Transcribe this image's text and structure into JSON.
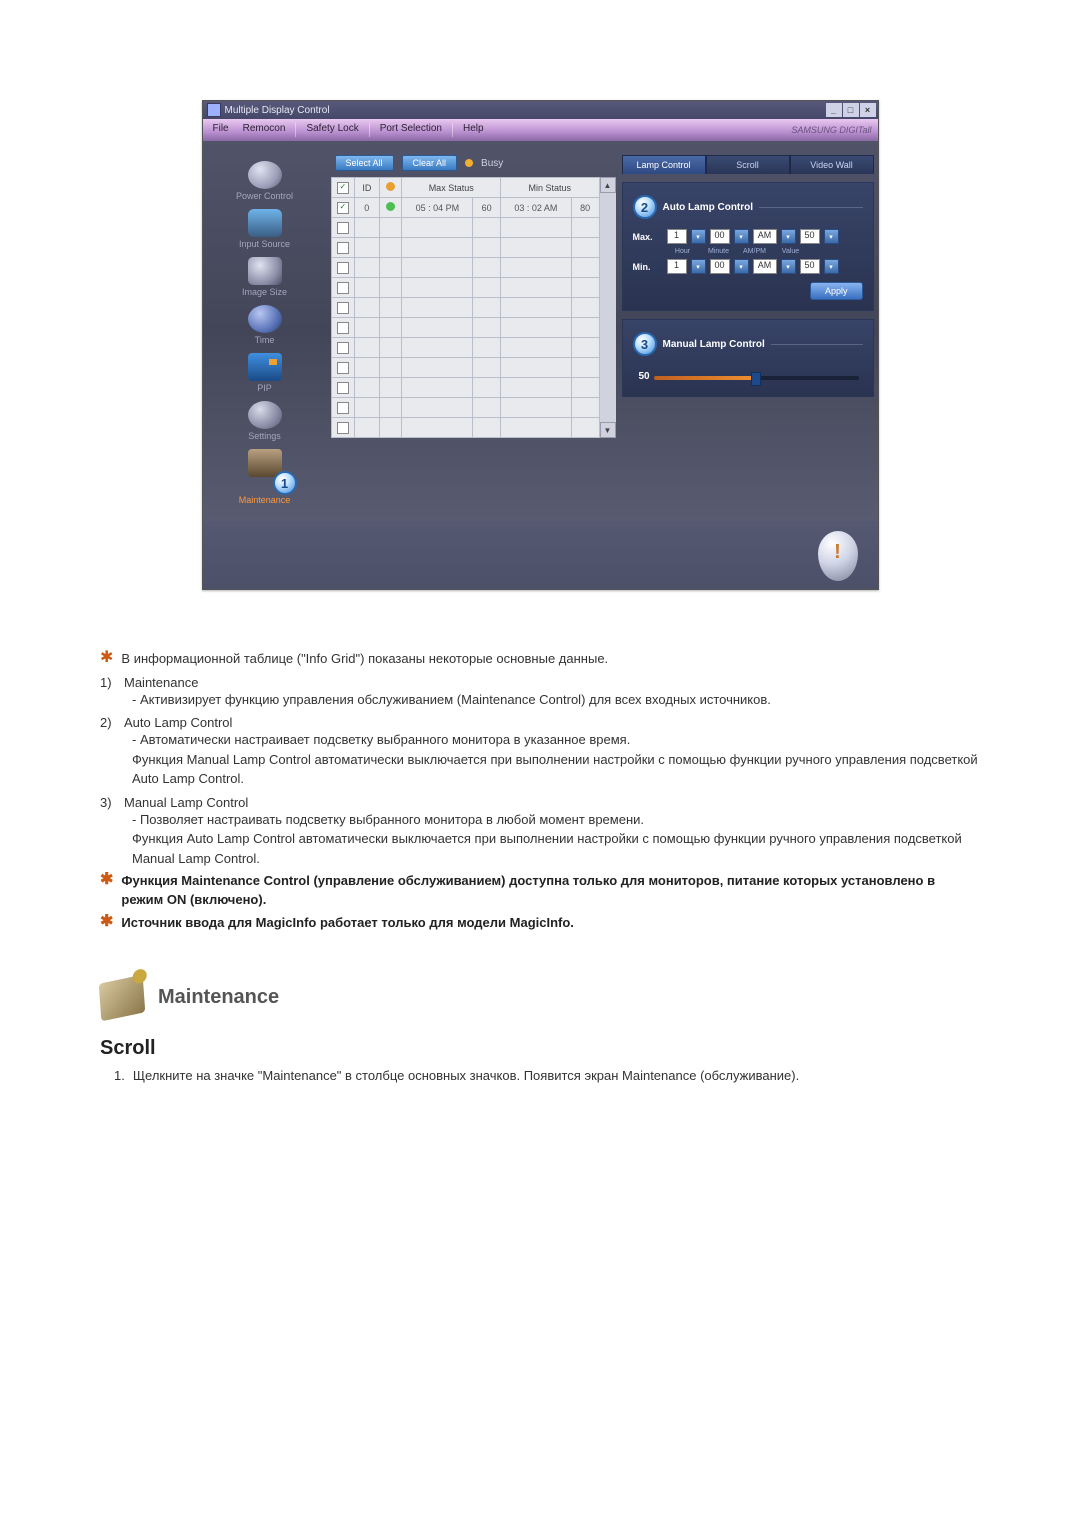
{
  "app": {
    "title": "Multiple Display Control",
    "menu": [
      "File",
      "Remocon",
      "Safety Lock",
      "Port Selection",
      "Help"
    ],
    "brand": "SAMSUNG DIGITall"
  },
  "sidebar": [
    {
      "label": "Power Control"
    },
    {
      "label": "Input Source"
    },
    {
      "label": "Image Size"
    },
    {
      "label": "Time"
    },
    {
      "label": "PIP"
    },
    {
      "label": "Settings"
    },
    {
      "label": "Maintenance"
    }
  ],
  "toolbar": {
    "select_all": "Select All",
    "clear_all": "Clear All",
    "busy": "Busy"
  },
  "grid": {
    "headers": {
      "id": "ID",
      "max": "Max Status",
      "min": "Min Status"
    },
    "row": {
      "id": "0",
      "max_time": "05 : 04 PM",
      "max_val": "60",
      "min_time": "03 : 02 AM",
      "min_val": "80"
    }
  },
  "tabs": {
    "lamp": "Lamp Control",
    "scroll": "Scroll",
    "video": "Video Wall"
  },
  "auto_lamp": {
    "title": "Auto Lamp Control",
    "max_label": "Max.",
    "min_label": "Min.",
    "sub_hour": "Hour",
    "sub_minute": "Minute",
    "sub_ampm": "AM/PM",
    "sub_value": "Value",
    "max_h": "1",
    "max_m": "00",
    "max_ap": "AM",
    "max_v": "50",
    "min_h": "1",
    "min_m": "00",
    "min_ap": "AM",
    "min_v": "50",
    "apply": "Apply"
  },
  "manual_lamp": {
    "title": "Manual Lamp Control",
    "value": "50"
  },
  "callouts": {
    "c1": "1",
    "c2": "2",
    "c3": "3"
  },
  "doc": {
    "info_grid": "В информационной таблице (\"Info Grid\") показаны некоторые основные данные.",
    "i1_t": "Maintenance",
    "i1_d": "- Активизирует функцию управления обслуживанием (Maintenance Control) для всех входных источников.",
    "i2_t": "Auto Lamp Control",
    "i2_d1": "- Автоматически настраивает подсветку выбранного монитора в указанное время.",
    "i2_d2": "Функция Manual Lamp Control автоматически выключается при выполнении настройки с помощью функции ручного управления подсветкой Auto Lamp Control.",
    "i3_t": "Manual Lamp Control",
    "i3_d1": "- Позволяет настраивать подсветку выбранного монитора в любой момент времени.",
    "i3_d2": "Функция Auto Lamp Control автоматически выключается при выполнении настройки с помощью функции ручного управления подсветкой Manual Lamp Control.",
    "note1": "Функция Maintenance Control (управление обслуживанием) доступна только для мониторов, питание которых установлено в режим ON (включено).",
    "note2": "Источник ввода для MagicInfo работает только для модели MagicInfo.",
    "maint_heading": "Maintenance",
    "scroll_heading": "Scroll",
    "scroll_step1": "Щелкните на значке \"Maintenance\" в столбце основных значков. Появится экран Maintenance (обслуживание)."
  }
}
